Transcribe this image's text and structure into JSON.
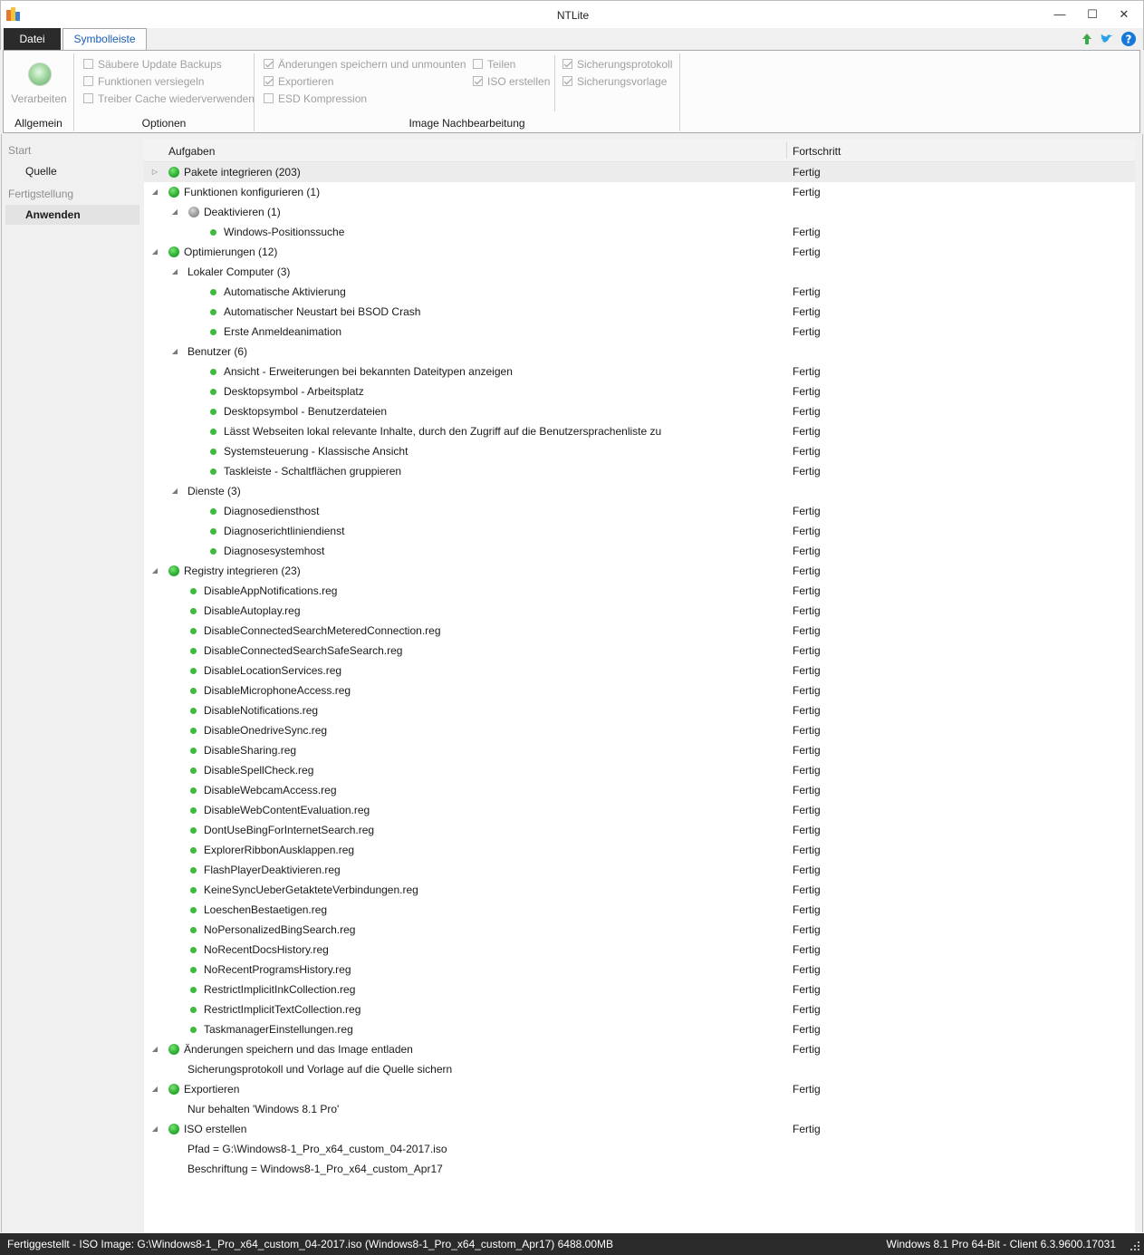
{
  "window": {
    "title": "NTLite",
    "minimize": "—",
    "maximize": "☐",
    "close": "✕"
  },
  "tabs": {
    "datei": "Datei",
    "symbolleiste": "Symbolleiste"
  },
  "ribbon": {
    "allgemein": {
      "button": "Verarbeiten",
      "label": "Allgemein"
    },
    "optionen": {
      "label": "Optionen",
      "items": [
        {
          "text": "Säubere Update Backups",
          "checked": false
        },
        {
          "text": "Funktionen versiegeln",
          "checked": false
        },
        {
          "text": "Treiber Cache wiederverwenden",
          "checked": false
        }
      ]
    },
    "image": {
      "label": "Image Nachbearbeitung",
      "items": [
        {
          "text": "Änderungen speichern und unmounten",
          "checked": true
        },
        {
          "text": "Exportieren",
          "checked": true
        },
        {
          "text": "ESD Kompression",
          "checked": false
        },
        {
          "text": "Teilen",
          "checked": false
        },
        {
          "text": "ISO erstellen",
          "checked": true
        },
        {
          "text": "Sicherungsprotokoll",
          "checked": true
        },
        {
          "text": "Sicherungsvorlage",
          "checked": true
        }
      ]
    }
  },
  "nav": {
    "start": "Start",
    "quelle": "Quelle",
    "fertigstellung": "Fertigstellung",
    "anwenden": "Anwenden"
  },
  "table": {
    "col_tasks": "Aufgaben",
    "col_progress": "Fortschritt",
    "rows": [
      {
        "text": "Pakete integrieren (203)",
        "level": 0,
        "exp": "closed",
        "icon": "green",
        "progress": "Fertig"
      },
      {
        "text": "Funktionen konfigurieren (1)",
        "level": 0,
        "exp": "open",
        "icon": "green",
        "progress": "Fertig"
      },
      {
        "text": "Deaktivieren (1)",
        "level": 1,
        "exp": "open",
        "icon": "gray",
        "progress": ""
      },
      {
        "text": "Windows-Positionssuche",
        "level": 2,
        "exp": "",
        "icon": "small",
        "progress": "Fertig"
      },
      {
        "text": "Optimierungen (12)",
        "level": 0,
        "exp": "open",
        "icon": "green",
        "progress": "Fertig"
      },
      {
        "text": "Lokaler Computer (3)",
        "level": 1,
        "exp": "open",
        "icon": "",
        "progress": ""
      },
      {
        "text": "Automatische Aktivierung",
        "level": 2,
        "exp": "",
        "icon": "small",
        "progress": "Fertig"
      },
      {
        "text": "Automatischer Neustart bei BSOD Crash",
        "level": 2,
        "exp": "",
        "icon": "small",
        "progress": "Fertig"
      },
      {
        "text": "Erste Anmeldeanimation",
        "level": 2,
        "exp": "",
        "icon": "small",
        "progress": "Fertig"
      },
      {
        "text": "Benutzer (6)",
        "level": 1,
        "exp": "open",
        "icon": "",
        "progress": ""
      },
      {
        "text": "Ansicht - Erweiterungen bei bekannten Dateitypen anzeigen",
        "level": 2,
        "exp": "",
        "icon": "small",
        "progress": "Fertig"
      },
      {
        "text": "Desktopsymbol - Arbeitsplatz",
        "level": 2,
        "exp": "",
        "icon": "small",
        "progress": "Fertig"
      },
      {
        "text": "Desktopsymbol - Benutzerdateien",
        "level": 2,
        "exp": "",
        "icon": "small",
        "progress": "Fertig"
      },
      {
        "text": "Lässt Webseiten lokal relevante Inhalte, durch den Zugriff auf die Benutzersprachenliste zu",
        "level": 2,
        "exp": "",
        "icon": "small",
        "progress": "Fertig"
      },
      {
        "text": "Systemsteuerung - Klassische Ansicht",
        "level": 2,
        "exp": "",
        "icon": "small",
        "progress": "Fertig"
      },
      {
        "text": "Taskleiste - Schaltflächen gruppieren",
        "level": 2,
        "exp": "",
        "icon": "small",
        "progress": "Fertig"
      },
      {
        "text": "Dienste (3)",
        "level": 1,
        "exp": "open",
        "icon": "",
        "progress": ""
      },
      {
        "text": "Diagnosediensthost",
        "level": 2,
        "exp": "",
        "icon": "small",
        "progress": "Fertig"
      },
      {
        "text": "Diagnoserichtliniendienst",
        "level": 2,
        "exp": "",
        "icon": "small",
        "progress": "Fertig"
      },
      {
        "text": "Diagnosesystemhost",
        "level": 2,
        "exp": "",
        "icon": "small",
        "progress": "Fertig"
      },
      {
        "text": "Registry integrieren (23)",
        "level": 0,
        "exp": "open",
        "icon": "green",
        "progress": "Fertig"
      },
      {
        "text": "DisableAppNotifications.reg",
        "level": 1,
        "exp": "",
        "icon": "small",
        "progress": "Fertig"
      },
      {
        "text": "DisableAutoplay.reg",
        "level": 1,
        "exp": "",
        "icon": "small",
        "progress": "Fertig"
      },
      {
        "text": "DisableConnectedSearchMeteredConnection.reg",
        "level": 1,
        "exp": "",
        "icon": "small",
        "progress": "Fertig"
      },
      {
        "text": "DisableConnectedSearchSafeSearch.reg",
        "level": 1,
        "exp": "",
        "icon": "small",
        "progress": "Fertig"
      },
      {
        "text": "DisableLocationServices.reg",
        "level": 1,
        "exp": "",
        "icon": "small",
        "progress": "Fertig"
      },
      {
        "text": "DisableMicrophoneAccess.reg",
        "level": 1,
        "exp": "",
        "icon": "small",
        "progress": "Fertig"
      },
      {
        "text": "DisableNotifications.reg",
        "level": 1,
        "exp": "",
        "icon": "small",
        "progress": "Fertig"
      },
      {
        "text": "DisableOnedriveSync.reg",
        "level": 1,
        "exp": "",
        "icon": "small",
        "progress": "Fertig"
      },
      {
        "text": "DisableSharing.reg",
        "level": 1,
        "exp": "",
        "icon": "small",
        "progress": "Fertig"
      },
      {
        "text": "DisableSpellCheck.reg",
        "level": 1,
        "exp": "",
        "icon": "small",
        "progress": "Fertig"
      },
      {
        "text": "DisableWebcamAccess.reg",
        "level": 1,
        "exp": "",
        "icon": "small",
        "progress": "Fertig"
      },
      {
        "text": "DisableWebContentEvaluation.reg",
        "level": 1,
        "exp": "",
        "icon": "small",
        "progress": "Fertig"
      },
      {
        "text": "DontUseBingForInternetSearch.reg",
        "level": 1,
        "exp": "",
        "icon": "small",
        "progress": "Fertig"
      },
      {
        "text": "ExplorerRibbonAusklappen.reg",
        "level": 1,
        "exp": "",
        "icon": "small",
        "progress": "Fertig"
      },
      {
        "text": "FlashPlayerDeaktivieren.reg",
        "level": 1,
        "exp": "",
        "icon": "small",
        "progress": "Fertig"
      },
      {
        "text": "KeineSyncUeberGetakteteVerbindungen.reg",
        "level": 1,
        "exp": "",
        "icon": "small",
        "progress": "Fertig"
      },
      {
        "text": "LoeschenBestaetigen.reg",
        "level": 1,
        "exp": "",
        "icon": "small",
        "progress": "Fertig"
      },
      {
        "text": "NoPersonalizedBingSearch.reg",
        "level": 1,
        "exp": "",
        "icon": "small",
        "progress": "Fertig"
      },
      {
        "text": "NoRecentDocsHistory.reg",
        "level": 1,
        "exp": "",
        "icon": "small",
        "progress": "Fertig"
      },
      {
        "text": "NoRecentProgramsHistory.reg",
        "level": 1,
        "exp": "",
        "icon": "small",
        "progress": "Fertig"
      },
      {
        "text": "RestrictImplicitInkCollection.reg",
        "level": 1,
        "exp": "",
        "icon": "small",
        "progress": "Fertig"
      },
      {
        "text": "RestrictImplicitTextCollection.reg",
        "level": 1,
        "exp": "",
        "icon": "small",
        "progress": "Fertig"
      },
      {
        "text": "TaskmanagerEinstellungen.reg",
        "level": 1,
        "exp": "",
        "icon": "small",
        "progress": "Fertig"
      },
      {
        "text": "Änderungen speichern und das Image entladen",
        "level": 0,
        "exp": "open",
        "icon": "green",
        "progress": "Fertig"
      },
      {
        "text": "Sicherungsprotokoll und Vorlage auf die Quelle sichern",
        "level": 1,
        "exp": "",
        "icon": "",
        "progress": ""
      },
      {
        "text": "Exportieren",
        "level": 0,
        "exp": "open",
        "icon": "green",
        "progress": "Fertig"
      },
      {
        "text": "Nur behalten 'Windows 8.1 Pro'",
        "level": 1,
        "exp": "",
        "icon": "",
        "progress": ""
      },
      {
        "text": "ISO erstellen",
        "level": 0,
        "exp": "open",
        "icon": "green",
        "progress": "Fertig"
      },
      {
        "text": "Pfad = G:\\Windows8-1_Pro_x64_custom_04-2017.iso",
        "level": 1,
        "exp": "",
        "icon": "",
        "progress": ""
      },
      {
        "text": "Beschriftung = Windows8-1_Pro_x64_custom_Apr17",
        "level": 1,
        "exp": "",
        "icon": "",
        "progress": ""
      }
    ]
  },
  "status": {
    "left": "Fertiggestellt - ISO Image: G:\\Windows8-1_Pro_x64_custom_04-2017.iso (Windows8-1_Pro_x64_custom_Apr17) 6488.00MB",
    "right": "Windows 8.1 Pro 64-Bit - Client 6.3.9600.17031"
  },
  "colors": {
    "accent": "#1c5fb6",
    "status_ok": "#2fb02f",
    "statusbar": "#2b2b2b"
  }
}
